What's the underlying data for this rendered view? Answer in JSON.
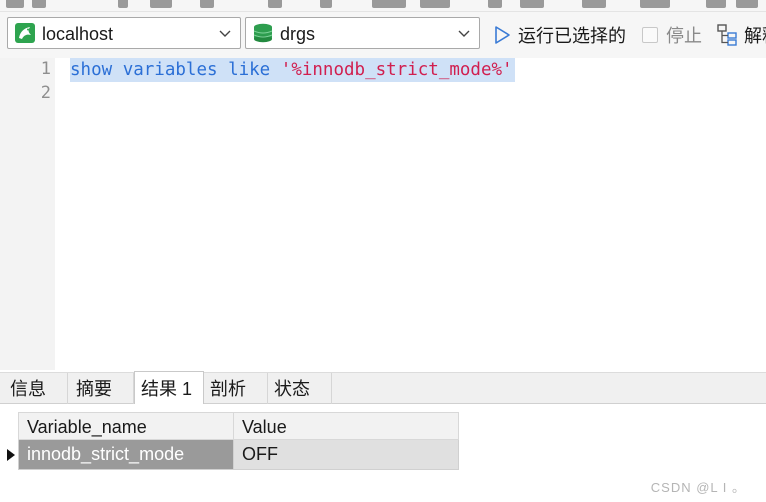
{
  "toolbar": {
    "connection": "localhost",
    "database": "drgs",
    "run_selected_label": "运行已选择的",
    "stop_label": "停止",
    "explain_label": "解释"
  },
  "editor": {
    "line_numbers": [
      "1",
      "2"
    ],
    "code": {
      "keyword1": "show",
      "space1": " ",
      "keyword2": "variables",
      "space2": " ",
      "keyword3": "like",
      "space3": " ",
      "string": "'%innodb_strict_mode%'"
    }
  },
  "result_tabs": [
    "信息",
    "摘要",
    "结果 1",
    "剖析",
    "状态"
  ],
  "result_grid": {
    "columns": [
      "Variable_name",
      "Value"
    ],
    "rows": [
      [
        "innodb_strict_mode",
        "OFF"
      ]
    ]
  },
  "watermark": "CSDN @L  I  。",
  "colors": {
    "keyword": "#2b6fd6",
    "string": "#d11f4f",
    "selection": "#cfe1f7",
    "run_icon": "#3a7bd5",
    "db_icon": "#2e9e4f"
  },
  "icons": {
    "connection": "mysql-dolphin-icon",
    "database": "database-cylinder-icon",
    "run": "play-icon",
    "explain": "explain-icon",
    "row_indicator": "row-pointer-icon"
  }
}
